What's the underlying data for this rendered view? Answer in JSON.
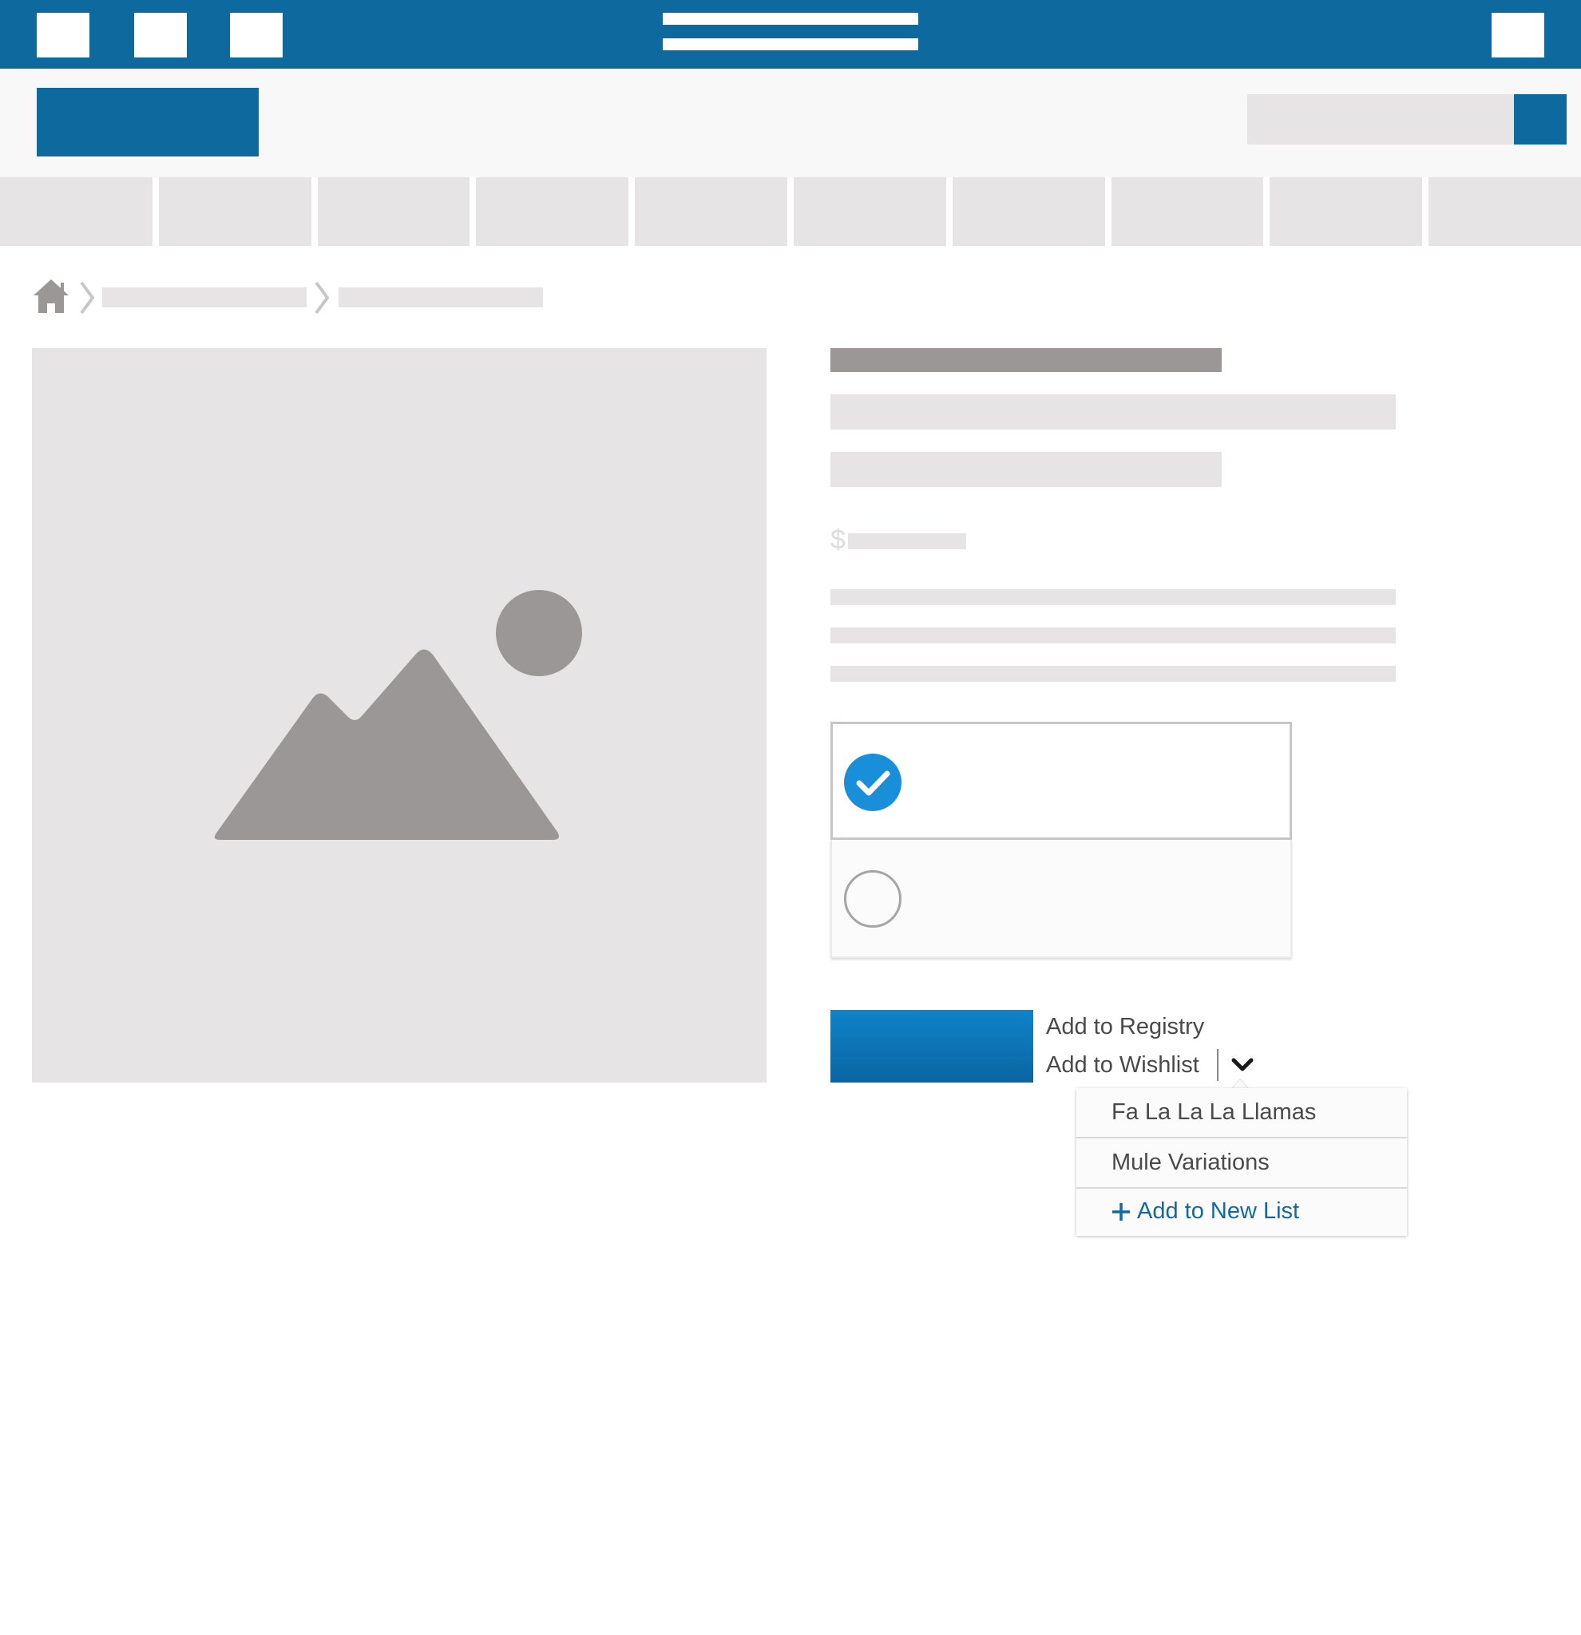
{
  "wishlist": {
    "add_to_registry": "Add to Registry",
    "add_to_wishlist": "Add to Wishlist",
    "lists": [
      "Fa La La La Llamas",
      "Mule Variations"
    ],
    "add_new_list": "Add to New List"
  },
  "product": {
    "price_symbol": "$"
  },
  "icons": {
    "home": "home-icon",
    "breadcrumb_separator": "chevron-right-icon",
    "image_placeholder": "image-icon",
    "selected": "check-circle-icon",
    "dropdown": "chevron-down-icon",
    "add": "plus-icon"
  },
  "colors": {
    "brand_blue": "#0e6a9e",
    "button_blue": "#0f83c9",
    "check_blue": "#1a8fd9",
    "placeholder_gray": "#e6e4e5",
    "icon_gray": "#9c9797",
    "link_blue": "#1268a0"
  }
}
